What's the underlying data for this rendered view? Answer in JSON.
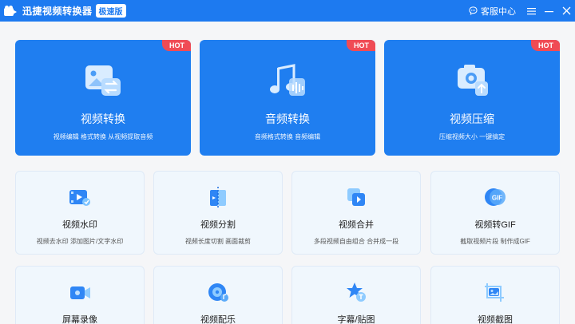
{
  "titlebar": {
    "app_title": "迅捷视频转换器",
    "edition": "极速版",
    "service_label": "客服中心",
    "buttons": [
      "menu-icon",
      "minimize-icon",
      "close-icon"
    ]
  },
  "big_cards": [
    {
      "title": "视频转换",
      "desc": "视频编辑  格式转换  从视频提取音频",
      "badge": "HOT"
    },
    {
      "title": "音频转换",
      "desc": "音频格式转换  音频编辑",
      "badge": "HOT"
    },
    {
      "title": "视频压缩",
      "desc": "压缩视频大小  一键搞定",
      "badge": "HOT"
    }
  ],
  "small_cards": [
    {
      "title": "视频水印",
      "desc": "视频去水印  添加图片/文字水印",
      "icon": "video-watermark-icon"
    },
    {
      "title": "视频分割",
      "desc": "视频长度切割  画面裁剪",
      "icon": "video-split-icon"
    },
    {
      "title": "视频合并",
      "desc": "多段视频自由组合  合并成一段",
      "icon": "video-merge-icon"
    },
    {
      "title": "视频转GIF",
      "desc": "截取视频片段  制作成GIF",
      "icon": "gif-icon"
    },
    {
      "title": "屏幕录像",
      "desc": "",
      "icon": "screen-record-icon"
    },
    {
      "title": "视频配乐",
      "desc": "",
      "icon": "music-disc-icon"
    },
    {
      "title": "字幕/贴图",
      "desc": "",
      "icon": "subtitle-icon"
    },
    {
      "title": "视频截图",
      "desc": "",
      "icon": "screenshot-icon"
    }
  ],
  "gif_icon_text": "GIF",
  "colors": {
    "primary": "#1d7af0",
    "hot": "#f04b55",
    "card_bg": "#f0f7fd"
  }
}
